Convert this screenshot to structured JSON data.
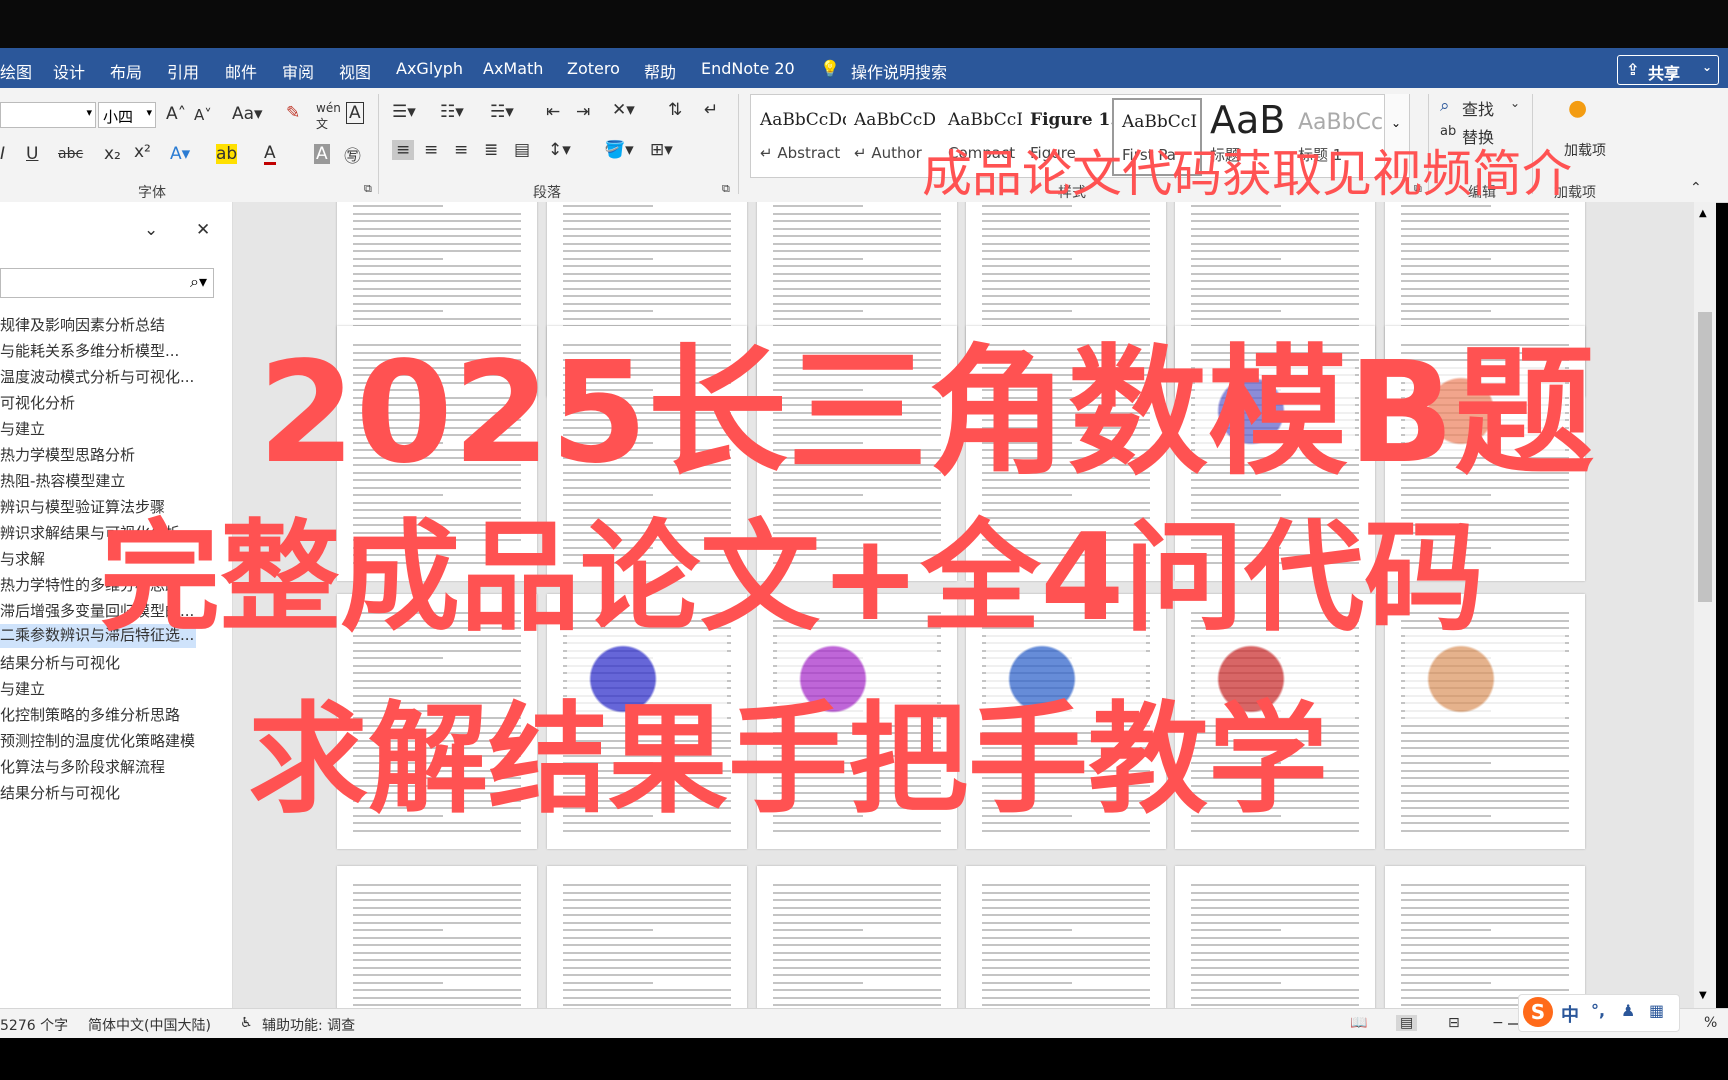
{
  "menu": [
    "绘图",
    "设计",
    "布局",
    "引用",
    "邮件",
    "审阅",
    "视图",
    "AxGlyph",
    "AxMath",
    "Zotero",
    "帮助",
    "EndNote 20"
  ],
  "tell_me": "操作说明搜索",
  "share": "共享",
  "font": {
    "size": "小四",
    "group_label": "字体"
  },
  "paragraph_label": "段落",
  "styles": {
    "label": "样式",
    "items": [
      {
        "sample": "AaBbCcDd",
        "name": "Abstract"
      },
      {
        "sample": "AaBbCcD",
        "name": "Author"
      },
      {
        "sample": "AaBbCcI",
        "name": "Compact"
      },
      {
        "sample": "Figure 1.",
        "name": "Figure"
      },
      {
        "sample": "AaBbCcI",
        "name": "First Pa"
      },
      {
        "sample": "AaB",
        "name": "标题"
      },
      {
        "sample": "AaBbCc",
        "name": "标题 1"
      }
    ]
  },
  "edit": {
    "find": "查找",
    "replace": "替换",
    "label": "编辑"
  },
  "addins": {
    "add": "加载项",
    "label": "加载项"
  },
  "nav_items": [
    "规律及影响因素分析总结",
    "与能耗关系多维分析模型...",
    "温度波动模式分析与可视化...",
    "可视化分析",
    "与建立",
    "热力学模型思路分析",
    "热阻-热容模型建立",
    "辨识与模型验证算法步骤",
    "辨识求解结果与可视化分析",
    "与求解",
    "热力学特性的多维分析思路",
    "滞后增强多变量回归模型的...",
    "二乘参数辨识与滞后特征选...",
    "结果分析与可视化",
    "与建立",
    "化控制策略的多维分析思路",
    "预测控制的温度优化策略建模",
    "化算法与多阶段求解流程",
    "结果分析与可视化"
  ],
  "status": {
    "words": "5276 个字",
    "lang": "简体中文(中国大陆)",
    "access": "辅助功能: 调查",
    "zoom": "%"
  },
  "ime": {
    "logo": "S",
    "lang": "中",
    "punct": "°,"
  },
  "overlay": {
    "top_caption": "成品论文代码获取见视频简介",
    "line1": "2025长三角数模B题",
    "line2": "完整成品论文+全4问代码",
    "line3": "求解结果手把手教学"
  }
}
